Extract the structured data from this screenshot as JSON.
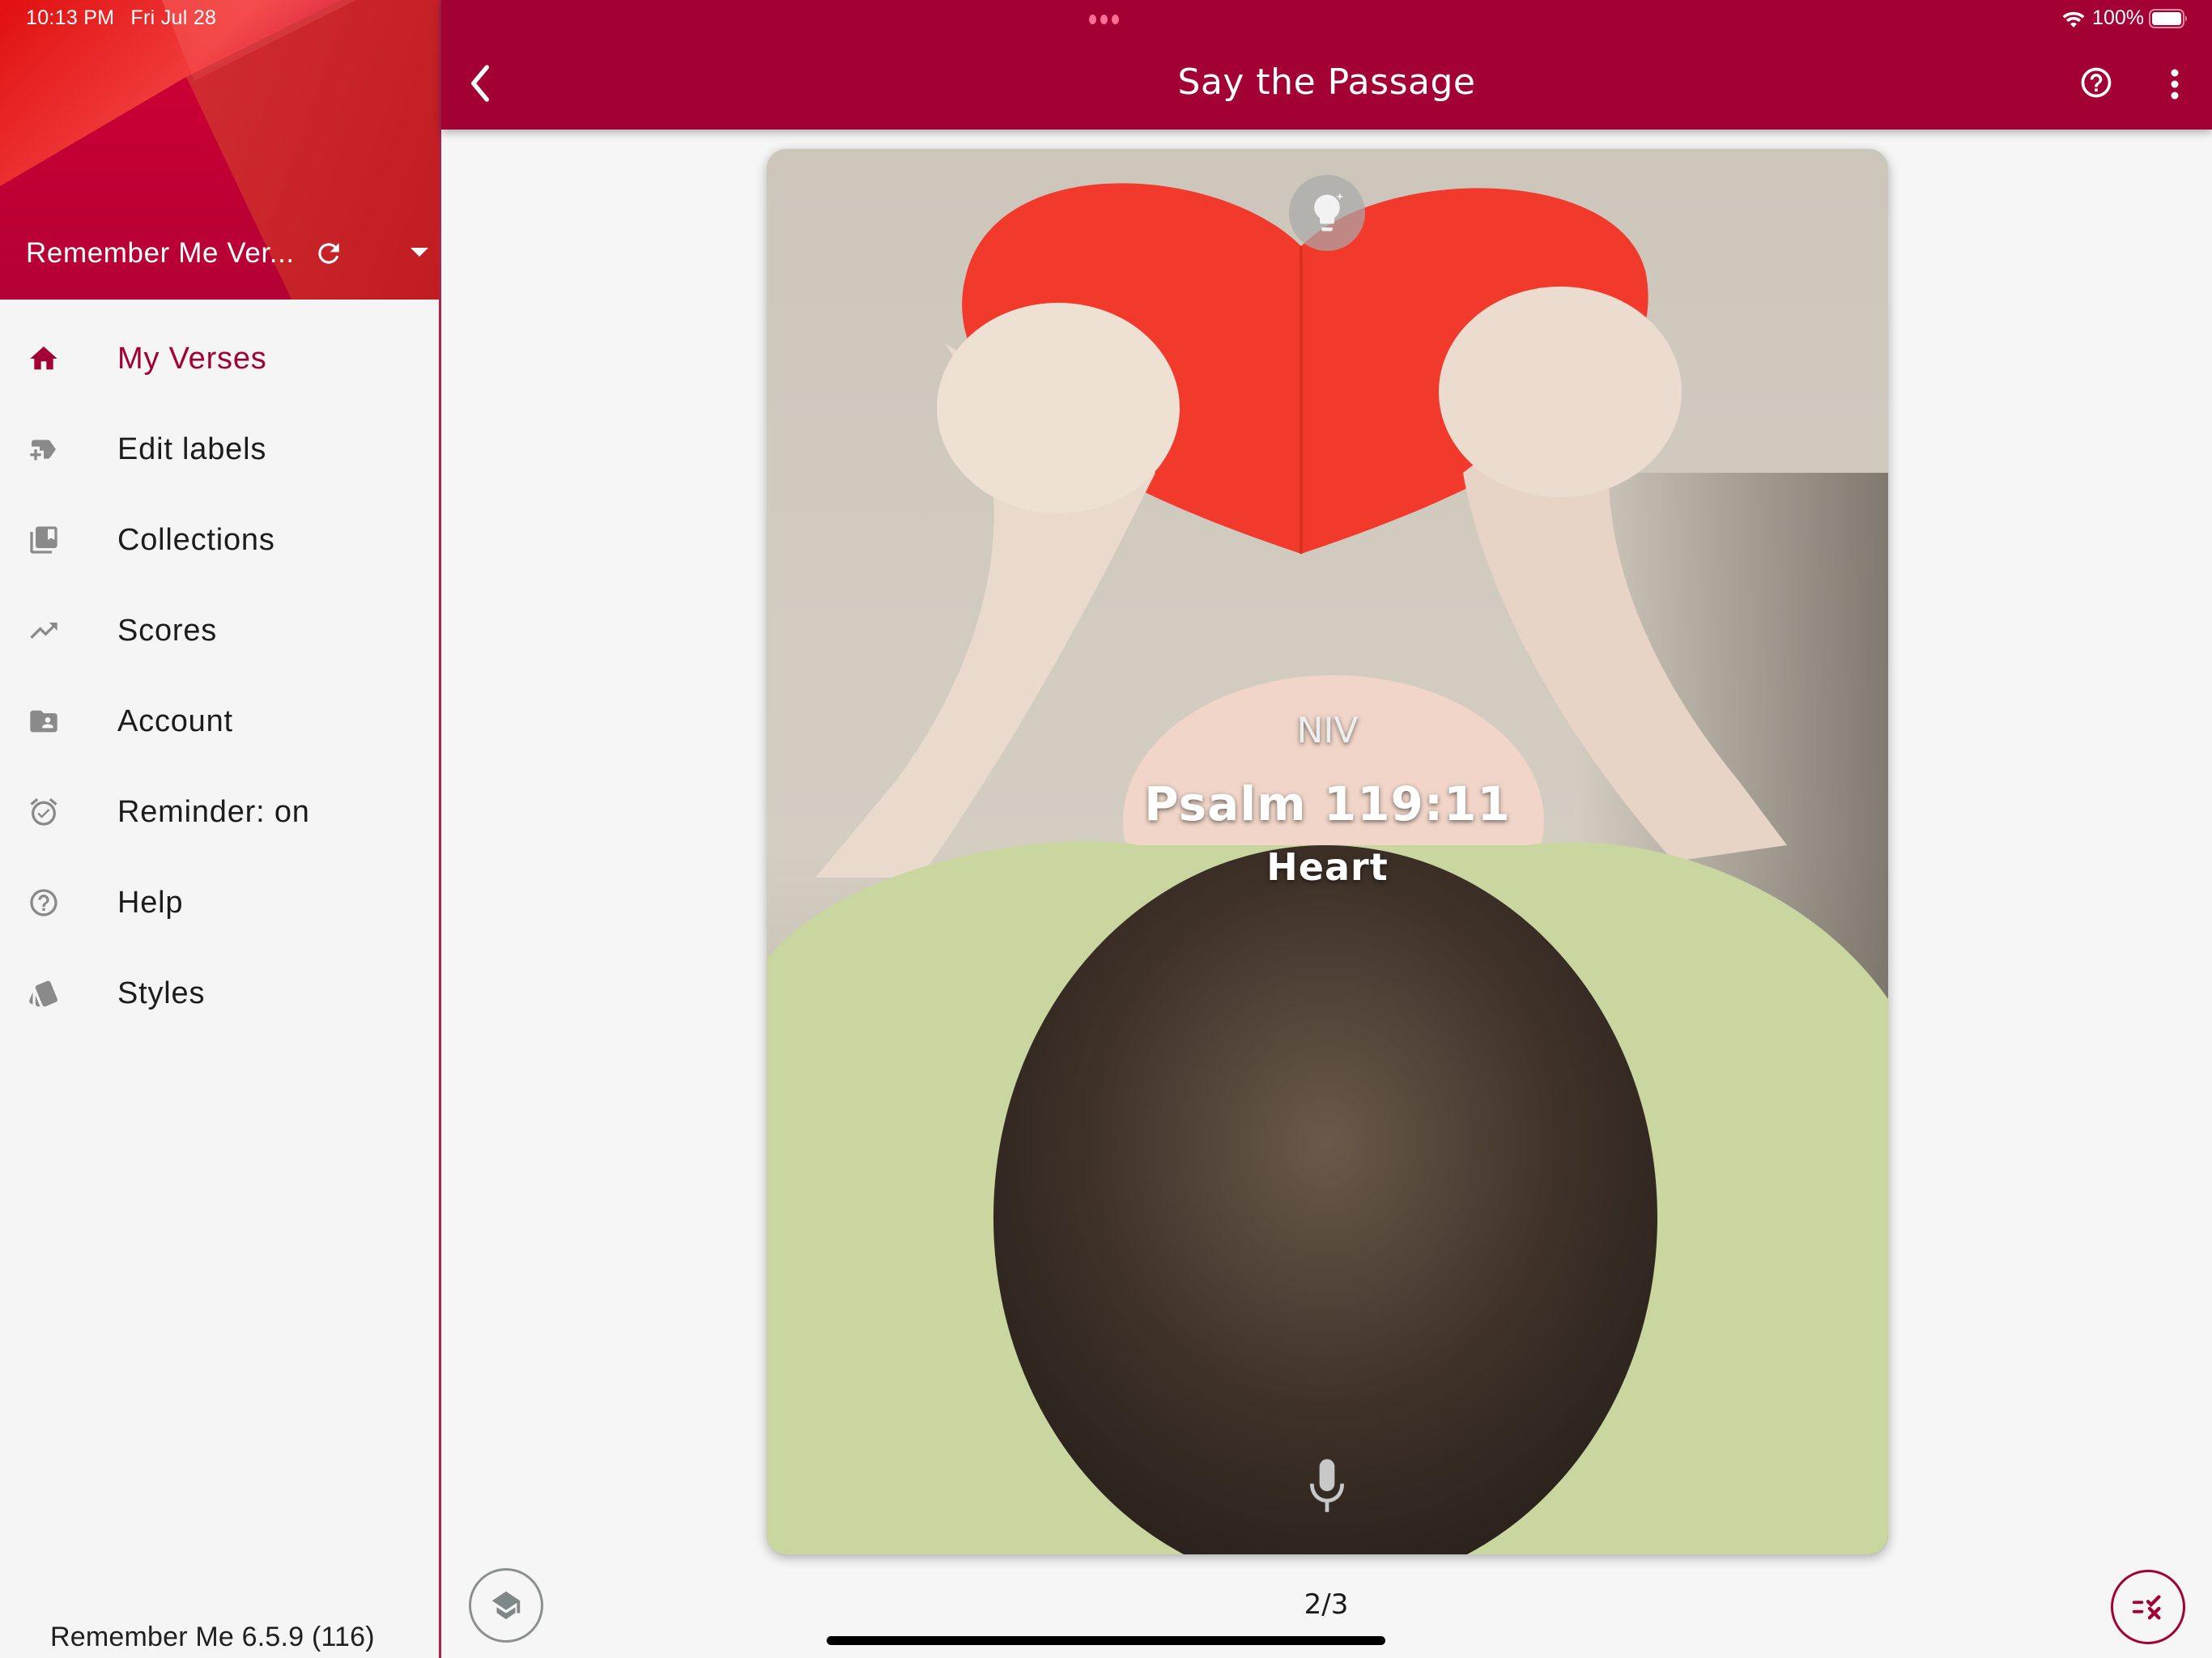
{
  "status_bar": {
    "time": "10:13 PM",
    "date": "Fri Jul 28",
    "battery": "100%"
  },
  "drawer": {
    "account_name": "Remember Me Ver...",
    "refresh_icon": "refresh-icon",
    "dropdown_icon": "dropdown-arrow-icon",
    "items": [
      {
        "label": "My Verses",
        "icon": "home-icon",
        "active": true
      },
      {
        "label": "Edit labels",
        "icon": "new-label-icon",
        "active": false
      },
      {
        "label": "Collections",
        "icon": "collections-bookmark-icon",
        "active": false
      },
      {
        "label": "Scores",
        "icon": "trending-up-icon",
        "active": false
      },
      {
        "label": "Account",
        "icon": "account-folder-icon",
        "active": false
      },
      {
        "label": "Reminder: on",
        "icon": "alarm-on-icon",
        "active": false
      },
      {
        "label": "Help",
        "icon": "help-circle-icon",
        "active": false
      },
      {
        "label": "Styles",
        "icon": "styles-cards-icon",
        "active": false
      }
    ],
    "version": "Remember Me 6.5.9 (116)"
  },
  "topbar": {
    "title": "Say the Passage",
    "back_icon": "chevron-left-icon",
    "help_icon": "help-circle-icon",
    "more_icon": "more-vertical-icon"
  },
  "card": {
    "translation": "NIV",
    "reference": "Psalm 119:11",
    "label": "Heart",
    "hint_icon": "lightbulb-icon",
    "mic_icon": "microphone-icon"
  },
  "footer": {
    "page_indicator": "2/3",
    "learn_icon": "graduation-cap-icon",
    "check_icon": "rule-check-icon"
  },
  "colors": {
    "brand": "#a30034",
    "icon_gray": "#8a8a8a",
    "background": "#f6f6f6"
  }
}
